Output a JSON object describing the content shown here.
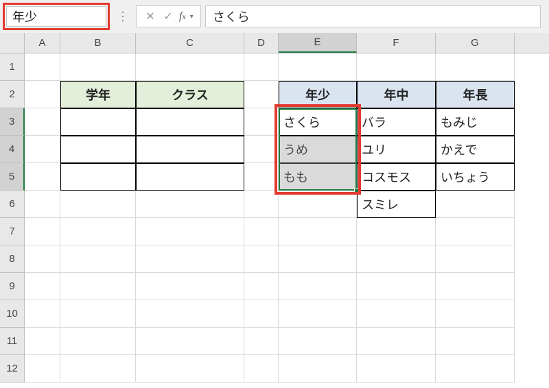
{
  "nameBox": "年少",
  "formulaValue": "さくら",
  "columns": [
    "A",
    "B",
    "C",
    "D",
    "E",
    "F",
    "G"
  ],
  "rows": [
    "1",
    "2",
    "3",
    "4",
    "5",
    "6",
    "7",
    "8",
    "9",
    "10",
    "11",
    "12"
  ],
  "table1": {
    "h1": "学年",
    "h2": "クラス"
  },
  "table2": {
    "hE": "年少",
    "hF": "年中",
    "hG": "年長",
    "r3E": "さくら",
    "r3F": "バラ",
    "r3G": "もみじ",
    "r4E": "うめ",
    "r4F": "ユリ",
    "r4G": "かえで",
    "r5E": "もも",
    "r5F": "コスモス",
    "r5G": "いちょう",
    "r6F": "スミレ"
  }
}
